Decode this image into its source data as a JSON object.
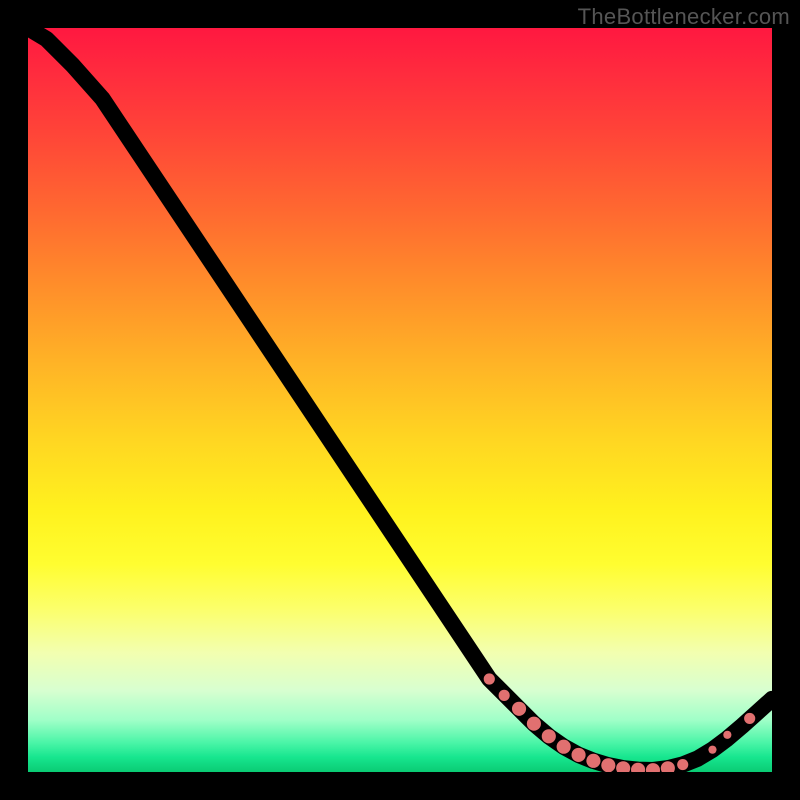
{
  "watermark": "TheBottlenecker.com",
  "chart_data": {
    "type": "line",
    "title": "",
    "xlabel": "",
    "ylabel": "",
    "xlim": [
      0,
      100
    ],
    "ylim": [
      0,
      100
    ],
    "x": [
      0,
      2.5,
      4,
      6,
      10,
      15,
      20,
      25,
      30,
      35,
      40,
      45,
      50,
      55,
      60,
      62,
      66,
      68,
      70,
      72,
      74,
      76,
      78,
      80,
      82,
      84,
      86,
      88,
      90,
      92,
      94,
      96,
      98,
      100
    ],
    "y": [
      100,
      98.5,
      97,
      95,
      90.5,
      83,
      75.5,
      68,
      60.5,
      53,
      45.5,
      38,
      30.5,
      23,
      15.5,
      12.5,
      8.5,
      6.5,
      4.8,
      3.4,
      2.3,
      1.5,
      0.9,
      0.5,
      0.3,
      0.25,
      0.5,
      1.0,
      1.8,
      3.0,
      4.5,
      6.2,
      8.0,
      9.8
    ],
    "highlight_points": {
      "x": [
        62,
        64,
        66,
        68,
        70,
        72,
        74,
        76,
        78,
        80,
        82,
        84,
        86,
        88,
        92,
        94,
        97
      ],
      "y": [
        12.5,
        10.3,
        8.5,
        6.5,
        4.8,
        3.4,
        2.3,
        1.5,
        0.9,
        0.5,
        0.3,
        0.25,
        0.5,
        1.0,
        3.0,
        5.0,
        7.2
      ],
      "size": [
        "md",
        "md",
        "lg",
        "lg",
        "lg",
        "lg",
        "lg",
        "lg",
        "lg",
        "lg",
        "lg",
        "lg",
        "lg",
        "md",
        "sm",
        "sm",
        "md"
      ]
    },
    "gradient_colors_top_to_bottom": [
      "#ff1840",
      "#ff6a30",
      "#ffd522",
      "#fffd30",
      "#d8ffd0",
      "#0acb73"
    ]
  }
}
